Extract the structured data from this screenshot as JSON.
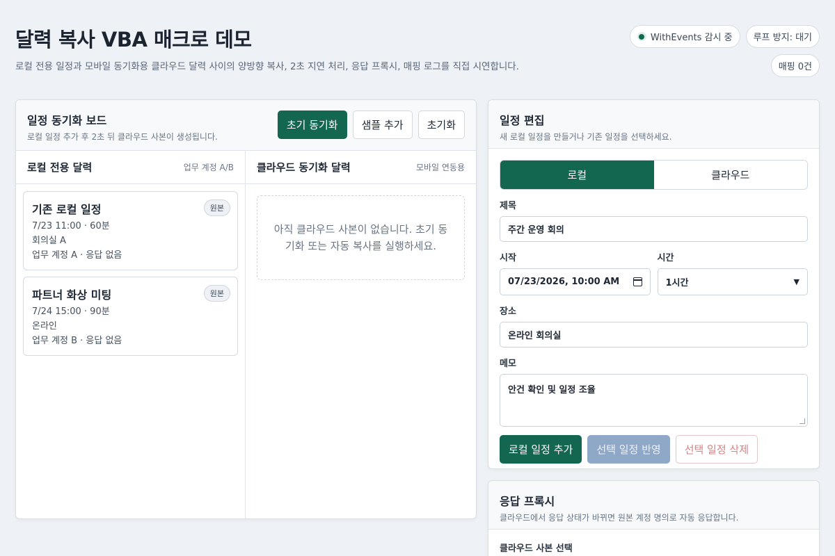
{
  "header": {
    "title": "달력 복사 VBA 매크로 데모",
    "subtitle": "로컬 전용 일정과 모바일 동기화용 클라우드 달력 사이의 양방향 복사, 2초 지연 처리, 응답 프록시, 매핑 로그를 직접 시연합니다."
  },
  "status": {
    "watch": "WithEvents 감시 중",
    "loop": "루프 방지: 대기",
    "mapping": "매핑 0건"
  },
  "board": {
    "title": "일정 동기화 보드",
    "subtitle": "로컬 일정 추가 후 2초 뒤 클라우드 사본이 생성됩니다.",
    "sync_label": "초기 동기화",
    "sample_label": "샘플 추가",
    "reset_label": "초기화",
    "local": {
      "title": "로컬 전용 달력",
      "tag": "업무 계정 A/B",
      "events": [
        {
          "title": "기존 로컬 일정",
          "badge": "원본",
          "when": "7/23 11:00 · 60분",
          "where": "회의실 A",
          "meta": "업무 계정 A · 응답 없음"
        },
        {
          "title": "파트너 화상 미팅",
          "badge": "원본",
          "when": "7/24 15:00 · 90분",
          "where": "온라인",
          "meta": "업무 계정 B · 응답 없음"
        }
      ]
    },
    "cloud": {
      "title": "클라우드 동기화 달력",
      "tag": "모바일 연동용",
      "empty": "아직 클라우드 사본이 없습니다. 초기 동기화 또는 자동 복사를 실행하세요."
    }
  },
  "editor": {
    "title": "일정 편집",
    "subtitle": "새 로컬 일정을 만들거나 기존 일정을 선택하세요.",
    "tab_local": "로컬",
    "tab_cloud": "클라우드",
    "subject_label": "제목",
    "subject_value": "주간 운영 회의",
    "start_label": "시작",
    "start_value": "07/23/2026, 10:00 AM",
    "duration_label": "시간",
    "duration_value": "1시간",
    "location_label": "장소",
    "location_value": "온라인 회의실",
    "memo_label": "메모",
    "memo_value": "안건 확인 및 일정 조율",
    "add_label": "로컬 일정 추가",
    "apply_label": "선택 일정 반영",
    "delete_label": "선택 일정 삭제"
  },
  "proxy": {
    "title": "응답 프록시",
    "subtitle": "클라우드에서 응답 상태가 바뀌면 원본 계정 명의로 자동 응답합니다.",
    "select_label": "클라우드 사본 선택"
  },
  "colors": {
    "primary": "#136650",
    "disabled": "#8fa8c8",
    "danger": "#d98282",
    "background": "#eef1f5"
  },
  "icons": {
    "watch": "status-dot-icon",
    "calendar": "calendar-icon",
    "select": "chevron-down-icon"
  }
}
